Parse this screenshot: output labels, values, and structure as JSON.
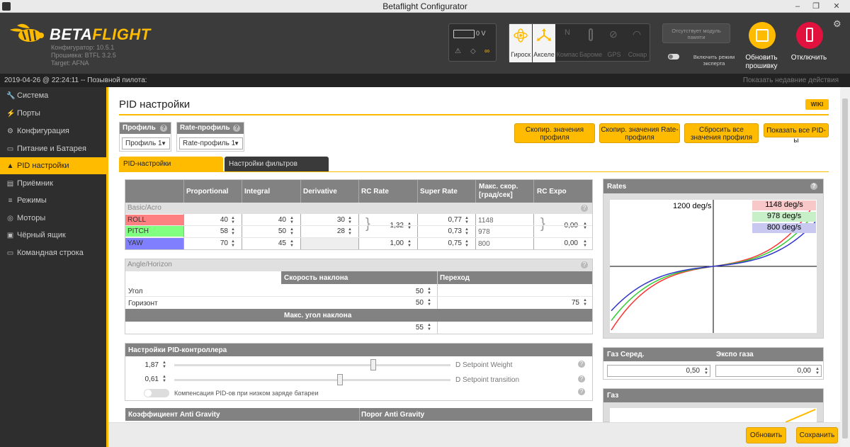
{
  "window": {
    "title": "Betaflight Configurator",
    "minimize": "–",
    "maximize": "❐",
    "close": "✕"
  },
  "header": {
    "logo_left": "BETA",
    "logo_right": "FLIGHT",
    "configurator": "Конфигуратор: 10.5.1",
    "firmware": "Прошивка: BTFL 3.2.5",
    "target": "Target: AFNA",
    "battery_voltage": "0 V",
    "sensors": [
      {
        "label": "Гироск",
        "icon": "gyro-icon",
        "active": true
      },
      {
        "label": "Акселе",
        "icon": "accel-icon",
        "active": true
      },
      {
        "label": "Компас",
        "icon": "compass-icon",
        "active": false
      },
      {
        "label": "Бароме",
        "icon": "baro-icon",
        "active": false
      },
      {
        "label": "GPS",
        "icon": "gps-icon",
        "active": false
      },
      {
        "label": "Сонар",
        "icon": "sonar-icon",
        "active": false
      }
    ],
    "memory_missing": "Отсутствует модуль памяти",
    "expert_mode": "Включить режим эксперта",
    "update_firmware": "Обновить прошивку",
    "disconnect": "Отключить",
    "accent": "#ffbb00",
    "disconnect_color": "#e2123f"
  },
  "status": {
    "left": "2019-04-26 @ 22:24:11 -- Позывной пилота:",
    "right": "Показать недавние действия"
  },
  "sidebar": {
    "items": [
      {
        "label": "Система",
        "icon": "wrench-icon",
        "active": false
      },
      {
        "label": "Порты",
        "icon": "plug-icon",
        "active": false
      },
      {
        "label": "Конфигурация",
        "icon": "gear-icon",
        "active": false
      },
      {
        "label": "Питание и Батарея",
        "icon": "battery-icon",
        "active": false
      },
      {
        "label": "PID настройки",
        "icon": "pid-icon",
        "active": true
      },
      {
        "label": "Приёмник",
        "icon": "receiver-icon",
        "active": false
      },
      {
        "label": "Режимы",
        "icon": "modes-icon",
        "active": false
      },
      {
        "label": "Моторы",
        "icon": "motor-icon",
        "active": false
      },
      {
        "label": "Чёрный ящик",
        "icon": "blackbox-icon",
        "active": false
      },
      {
        "label": "Командная строка",
        "icon": "cli-icon",
        "active": false
      }
    ]
  },
  "page": {
    "title_prefix": "PID",
    "title_rest": " настройки",
    "wiki": "WIKI",
    "profile_label": "Профиль",
    "profile_value": "Профиль 1",
    "rate_profile_label": "Rate-профиль",
    "rate_profile_value": "Rate-профиль 1",
    "buttons": [
      "Скопир. значения профиля",
      "Скопир. значения Rate-профиля",
      "Сбросить все значения профиля",
      "Показать все PID-ы"
    ],
    "tabs": [
      "PID-настройки",
      "Настройки фильтров"
    ]
  },
  "pid": {
    "headers": [
      "Proportional",
      "Integral",
      "Derivative",
      "RC Rate",
      "Super Rate",
      "Макс. скор. [град/сек]",
      "RC Expo"
    ],
    "section": "Basic/Acro",
    "rows": [
      {
        "name": "ROLL",
        "color": "#ff8080",
        "p": "40",
        "i": "40",
        "d": "30",
        "super": "0,77",
        "max": "1148"
      },
      {
        "name": "PITCH",
        "color": "#80ff80",
        "p": "58",
        "i": "50",
        "d": "28",
        "super": "0,73",
        "max": "978"
      },
      {
        "name": "YAW",
        "color": "#8080ff",
        "p": "70",
        "i": "45",
        "d": "",
        "rc_rate": "1,00",
        "super": "0,75",
        "max": "800",
        "expo": "0,00"
      }
    ],
    "rc_rate_rp": "1,32",
    "expo_rp": "0,00"
  },
  "angle": {
    "section": "Angle/Horizon",
    "col_tilt": "Скорость наклона",
    "col_trans": "Переход",
    "angle_label": "Угол",
    "angle_value": "50",
    "horizon_label": "Горизонт",
    "horizon_value": "50",
    "transition_value": "75",
    "max_tilt_label": "Макс. угол наклона",
    "max_tilt_value": "55"
  },
  "pidctrl": {
    "title": "Настройки PID-контроллера",
    "weight_value": "1,87",
    "weight_label": "D Setpoint Weight",
    "transition_value": "0,61",
    "transition_label": "D Setpoint transition",
    "weight_fraction": 0.72,
    "transition_fraction": 0.6,
    "battery_comp": "Компенсация PID-ов при низком заряде батареи"
  },
  "antigravity": {
    "col1": "Коэффициент Anti Gravity",
    "col2": "Порог Anti Gravity"
  },
  "rates": {
    "title": "Rates",
    "max_label": "1200 deg/s",
    "legend": [
      "1148 deg/s",
      "978 deg/s",
      "800 deg/s"
    ],
    "colors": [
      "#ff3333",
      "#33cc33",
      "#3333cc"
    ]
  },
  "throttle_mid": {
    "col1": "Газ Серед.",
    "col2": "Экспо газа",
    "mid_value": "0,50",
    "expo_value": "0,00"
  },
  "throttle": {
    "title": "Газ"
  },
  "actions": {
    "refresh": "Обновить",
    "save": "Сохранить"
  }
}
